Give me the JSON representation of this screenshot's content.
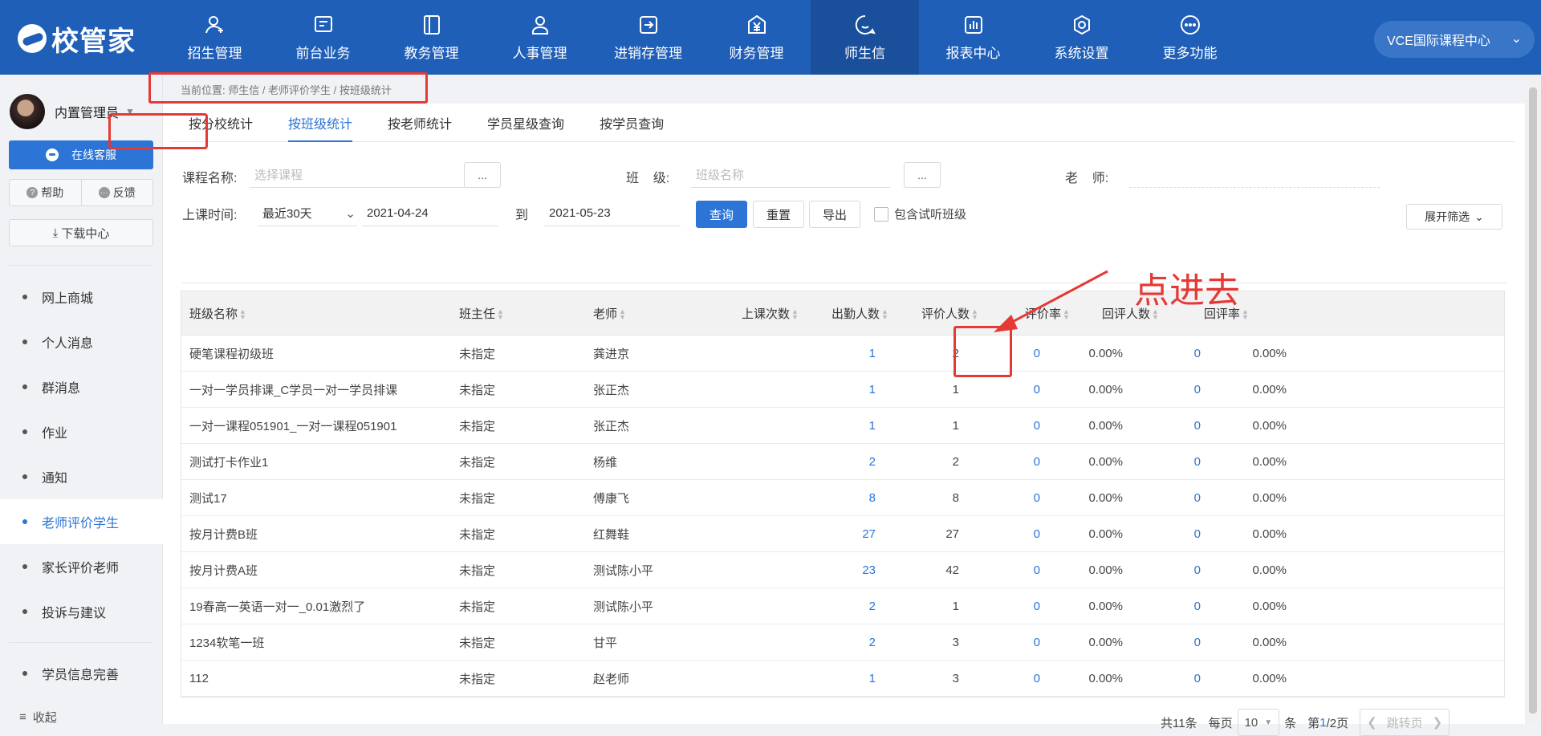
{
  "app": {
    "brand": "校管家"
  },
  "nav": [
    {
      "label": "招生管理",
      "icon": "user-plus-icon"
    },
    {
      "label": "前台业务",
      "icon": "screen-icon"
    },
    {
      "label": "教务管理",
      "icon": "book-icon"
    },
    {
      "label": "人事管理",
      "icon": "person-icon"
    },
    {
      "label": "进销存管理",
      "icon": "arrow-box-icon"
    },
    {
      "label": "财务管理",
      "icon": "yen-icon"
    },
    {
      "label": "师生信",
      "icon": "chat-icon",
      "active": true
    },
    {
      "label": "报表中心",
      "icon": "bar-report-icon"
    },
    {
      "label": "系统设置",
      "icon": "settings-icon"
    },
    {
      "label": "更多功能",
      "icon": "more-icon"
    }
  ],
  "campus": "VCE国际课程中心",
  "sidebar": {
    "user": "内置管理员",
    "service": "在线客服",
    "help": "帮助",
    "feedback": "反馈",
    "download": "下载中心",
    "items": [
      {
        "label": "网上商城"
      },
      {
        "label": "个人消息"
      },
      {
        "label": "群消息"
      },
      {
        "label": "作业"
      },
      {
        "label": "通知"
      },
      {
        "label": "老师评价学生",
        "active": true
      },
      {
        "label": "家长评价老师"
      },
      {
        "label": "投诉与建议"
      },
      {
        "label": "学员信息完善"
      }
    ],
    "collapse": "收起"
  },
  "breadcrumb": "当前位置:  师生信 / 老师评价学生 / 按班级统计",
  "tabs": [
    "按分校统计",
    "按班级统计",
    "按老师统计",
    "学员星级查询",
    "按学员查询"
  ],
  "filters": {
    "course_label": "课程名称:",
    "course_placeholder": "选择课程",
    "dots": "...",
    "class_label": "班    级:",
    "class_placeholder": "班级名称",
    "teacher_label": "老    师:",
    "time_label": "上课时间:",
    "time_range": "最近30天",
    "date_from": "2021-04-24",
    "to": "到",
    "date_to": "2021-05-23",
    "query": "查询",
    "reset": "重置",
    "export": "导出",
    "include_trial": "包含试听班级",
    "expand": "展开筛选"
  },
  "table": {
    "headers": [
      "班级名称",
      "班主任",
      "老师",
      "上课次数",
      "出勤人数",
      "评价人数",
      "评价率",
      "回评人数",
      "回评率"
    ],
    "rows": [
      [
        "硬笔课程初级班",
        "未指定",
        "龚进京",
        "1",
        "2",
        "0",
        "0.00%",
        "0",
        "0.00%"
      ],
      [
        "一对一学员排课_C学员一对一学员排课",
        "未指定",
        "张正杰",
        "1",
        "1",
        "0",
        "0.00%",
        "0",
        "0.00%"
      ],
      [
        "一对一课程051901_一对一课程051901",
        "未指定",
        "张正杰",
        "1",
        "1",
        "0",
        "0.00%",
        "0",
        "0.00%"
      ],
      [
        "测试打卡作业1",
        "未指定",
        "杨维",
        "2",
        "2",
        "0",
        "0.00%",
        "0",
        "0.00%"
      ],
      [
        "测试17",
        "未指定",
        "傅康飞",
        "8",
        "8",
        "0",
        "0.00%",
        "0",
        "0.00%"
      ],
      [
        "按月计费B班",
        "未指定",
        "红舞鞋",
        "27",
        "27",
        "0",
        "0.00%",
        "0",
        "0.00%"
      ],
      [
        "按月计费A班",
        "未指定",
        "测试陈小平",
        "23",
        "42",
        "0",
        "0.00%",
        "0",
        "0.00%"
      ],
      [
        "19春高一英语一对一_0.01激烈了",
        "未指定",
        "测试陈小平",
        "2",
        "1",
        "0",
        "0.00%",
        "0",
        "0.00%"
      ],
      [
        "1234软笔一班",
        "未指定",
        "甘平",
        "2",
        "3",
        "0",
        "0.00%",
        "0",
        "0.00%"
      ],
      [
        "112",
        "未指定",
        "赵老师",
        "1",
        "3",
        "0",
        "0.00%",
        "0",
        "0.00%"
      ]
    ]
  },
  "pager": {
    "total": "共11条",
    "per": "每页",
    "size": "10",
    "unit": "条",
    "page_prefix": "第",
    "page": "1",
    "page_suffix": "/2页",
    "jump": "跳转页"
  },
  "annotation": "点进去",
  "colors": {
    "brand": "#1f5fb8",
    "accent": "#2c74d6",
    "highlight": "#e53935"
  }
}
